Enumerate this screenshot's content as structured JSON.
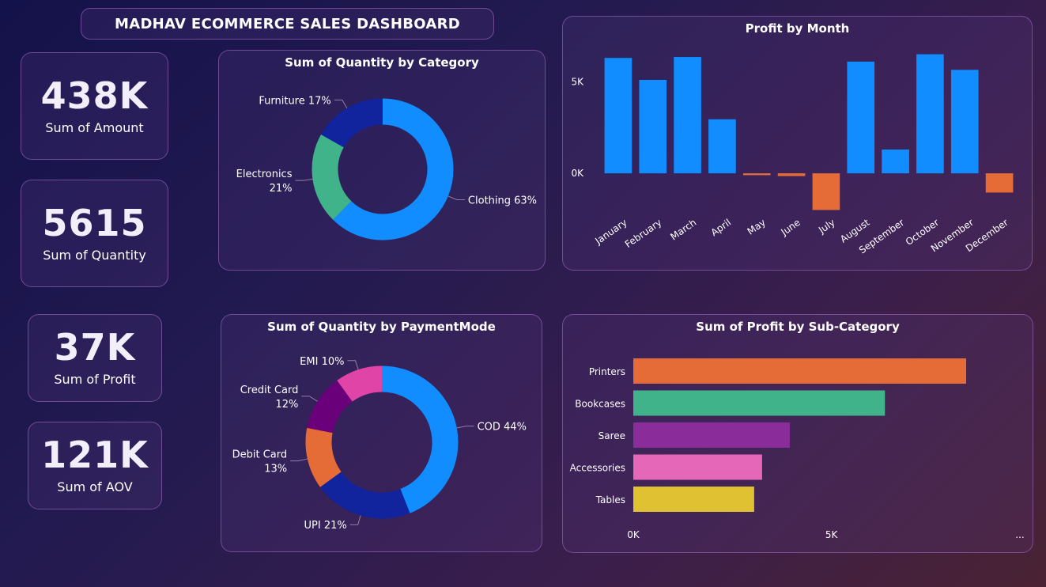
{
  "dashboard": {
    "title": "MADHAV ECOMMERCE SALES DASHBOARD"
  },
  "kpis": [
    {
      "value": "438K",
      "label": "Sum of Amount"
    },
    {
      "value": "5615",
      "label": "Sum of Quantity"
    },
    {
      "value": "37K",
      "label": "Sum of Profit"
    },
    {
      "value": "121K",
      "label": "Sum of AOV"
    }
  ],
  "chart_data": [
    {
      "type": "pie",
      "title": "Sum of Quantity by Category",
      "slices": [
        {
          "label": "Clothing",
          "percent": 63,
          "display": "Clothing 63%",
          "color": "#118dff"
        },
        {
          "label": "Electronics",
          "percent": 21,
          "display": [
            "Electronics",
            "21%"
          ],
          "color": "#41b38a"
        },
        {
          "label": "Furniture",
          "percent": 17,
          "display": "Furniture 17%",
          "color": "#12239e"
        }
      ]
    },
    {
      "type": "bar",
      "title": "Profit by Month",
      "categories": [
        "January",
        "February",
        "March",
        "April",
        "May",
        "June",
        "July",
        "August",
        "September",
        "October",
        "November",
        "December"
      ],
      "values": [
        6300,
        5100,
        6350,
        2950,
        -100,
        -150,
        -2000,
        6100,
        1300,
        6500,
        5650,
        -1050
      ],
      "ytick_labels": [
        "0K",
        "5K"
      ],
      "yticks": [
        0,
        5000
      ],
      "ylim": [
        -2500,
        7000
      ],
      "positive_color": "#118dff",
      "negative_color": "#e66c37"
    },
    {
      "type": "pie",
      "title": "Sum of Quantity by PaymentMode",
      "slices": [
        {
          "label": "COD",
          "percent": 44,
          "display": "COD 44%",
          "color": "#118dff"
        },
        {
          "label": "UPI",
          "percent": 21,
          "display": "UPI 21%",
          "color": "#12239e"
        },
        {
          "label": "Debit Card",
          "percent": 13,
          "display": [
            "Debit Card",
            "13%"
          ],
          "color": "#e66c37"
        },
        {
          "label": "Credit Card",
          "percent": 12,
          "display": [
            "Credit Card",
            "12%"
          ],
          "color": "#6b007b"
        },
        {
          "label": "EMI",
          "percent": 10,
          "display": "EMI 10%",
          "color": "#e044a7"
        }
      ]
    },
    {
      "type": "bar",
      "orientation": "horizontal",
      "title": "Sum of Profit by Sub-Category",
      "categories": [
        "Printers",
        "Bookcases",
        "Saree",
        "Accessories",
        "Tables"
      ],
      "values": [
        8400,
        6350,
        3950,
        3250,
        3050
      ],
      "colors": [
        "#e66c37",
        "#41b38a",
        "#8a2d9a",
        "#e568b8",
        "#dfc132"
      ],
      "xtick_labels": [
        "0K",
        "5K"
      ],
      "xticks": [
        0,
        5000
      ],
      "xlim": [
        0,
        8400
      ],
      "overflow_marker": "..."
    }
  ]
}
